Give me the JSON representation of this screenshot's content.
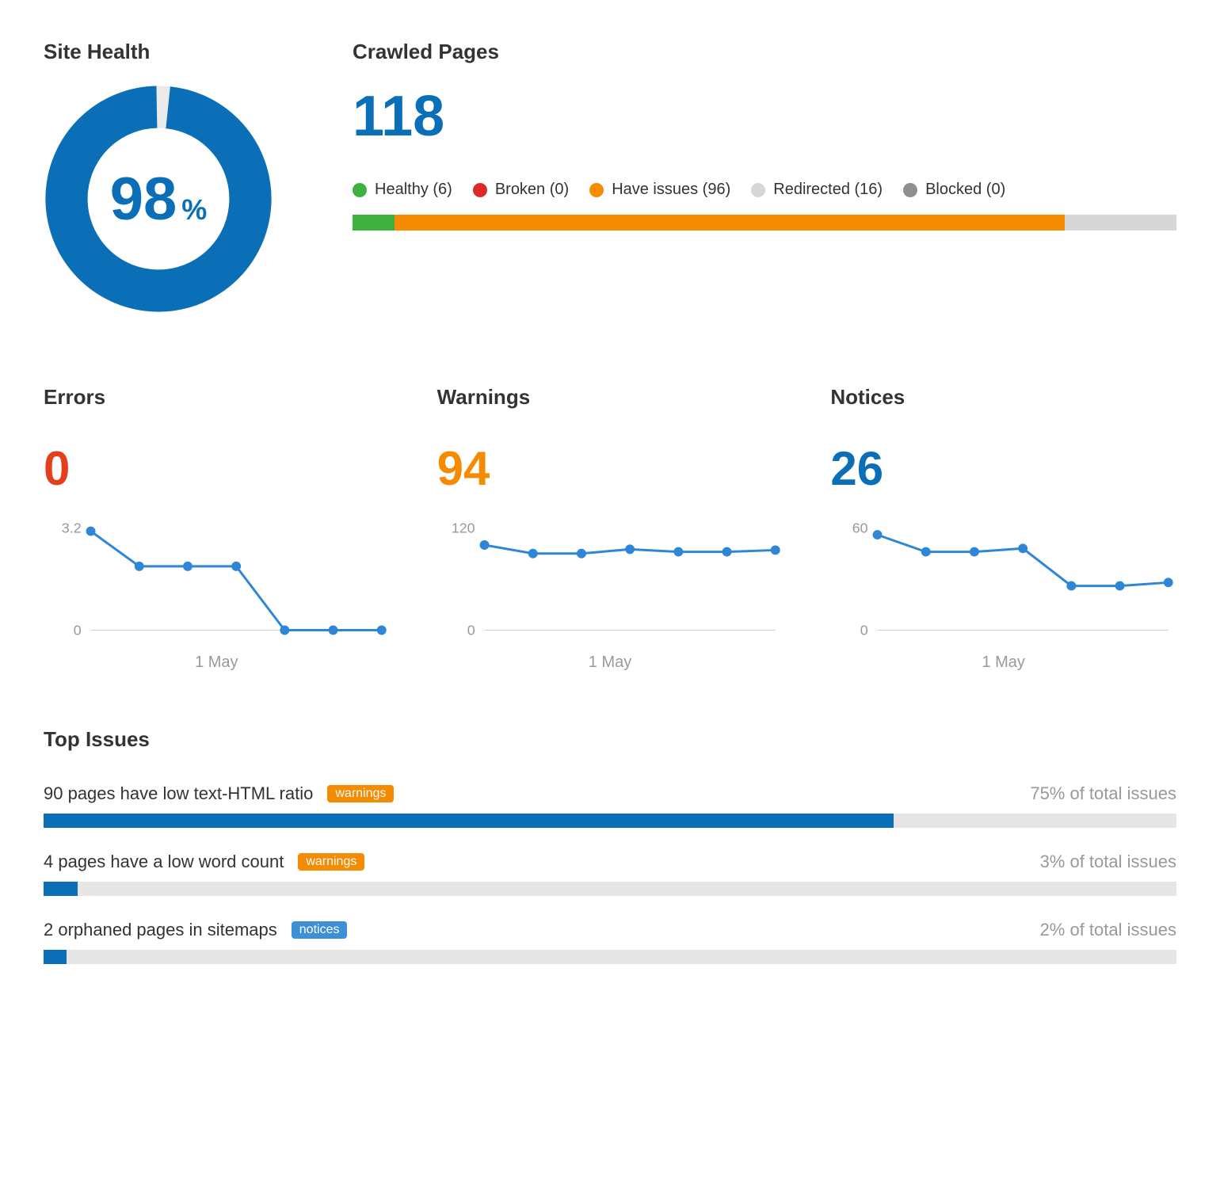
{
  "site_health": {
    "title": "Site Health",
    "score": 98,
    "unit": "%"
  },
  "crawled": {
    "title": "Crawled Pages",
    "total": 118,
    "legend": [
      {
        "label": "Healthy",
        "count": 6,
        "color": "#3db03d"
      },
      {
        "label": "Broken",
        "count": 0,
        "color": "#e02929"
      },
      {
        "label": "Have issues",
        "count": 96,
        "color": "#f48b00"
      },
      {
        "label": "Redirected",
        "count": 16,
        "color": "#d7d7d7"
      },
      {
        "label": "Blocked",
        "count": 0,
        "color": "#8f8f8f"
      }
    ]
  },
  "mini_panels": {
    "errors": {
      "title": "Errors",
      "value": 0
    },
    "warnings": {
      "title": "Warnings",
      "value": 94
    },
    "notices": {
      "title": "Notices",
      "value": 26
    }
  },
  "top_issues": {
    "title": "Top Issues",
    "suffix": "of total issues",
    "items": [
      {
        "label": "90 pages have low text-HTML ratio",
        "tag": "warnings",
        "tag_kind": "warn",
        "pct": 75
      },
      {
        "label": "4 pages have a low word count",
        "tag": "warnings",
        "tag_kind": "warn",
        "pct": 3
      },
      {
        "label": "2 orphaned pages in sitemaps",
        "tag": "notices",
        "tag_kind": "notice",
        "pct": 2
      }
    ]
  },
  "chart_data": [
    {
      "type": "line",
      "name": "errors_sparkline",
      "x": [
        1,
        2,
        3,
        4,
        5,
        6,
        7
      ],
      "values": [
        3.1,
        2.0,
        2.0,
        2.0,
        0,
        0,
        0
      ],
      "ylim": [
        0,
        3.2
      ],
      "yticks": [
        0,
        3.2
      ],
      "x_tick_label": "1 May",
      "color": "#2f86d6"
    },
    {
      "type": "line",
      "name": "warnings_sparkline",
      "x": [
        1,
        2,
        3,
        4,
        5,
        6,
        7
      ],
      "values": [
        100,
        90,
        90,
        95,
        92,
        92,
        94
      ],
      "ylim": [
        0,
        120
      ],
      "yticks": [
        0,
        120
      ],
      "x_tick_label": "1 May",
      "color": "#2f86d6"
    },
    {
      "type": "line",
      "name": "notices_sparkline",
      "x": [
        1,
        2,
        3,
        4,
        5,
        6,
        7
      ],
      "values": [
        56,
        46,
        46,
        48,
        26,
        26,
        28
      ],
      "ylim": [
        0,
        60
      ],
      "yticks": [
        0,
        60
      ],
      "x_tick_label": "1 May",
      "color": "#2f86d6"
    }
  ]
}
